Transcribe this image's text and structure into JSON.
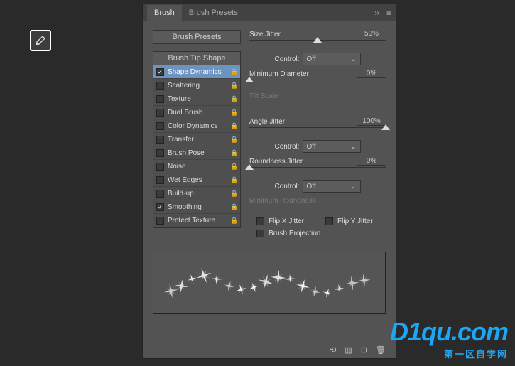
{
  "tool_icon": "brush-icon",
  "tabs": {
    "brush": "Brush",
    "presets": "Brush Presets"
  },
  "brush_presets_btn": "Brush Presets",
  "brush_tip_shape": "Brush Tip Shape",
  "options": [
    {
      "label": "Shape Dynamics",
      "checked": true,
      "selected": true
    },
    {
      "label": "Scattering",
      "checked": false
    },
    {
      "label": "Texture",
      "checked": false
    },
    {
      "label": "Dual Brush",
      "checked": false
    },
    {
      "label": "Color Dynamics",
      "checked": false
    },
    {
      "label": "Transfer",
      "checked": false
    },
    {
      "label": "Brush Pose",
      "checked": false
    },
    {
      "label": "Noise",
      "checked": false
    },
    {
      "label": "Wet Edges",
      "checked": false
    },
    {
      "label": "Build-up",
      "checked": false
    },
    {
      "label": "Smoothing",
      "checked": true
    },
    {
      "label": "Protect Texture",
      "checked": false
    }
  ],
  "fields": {
    "size_jitter": {
      "label": "Size Jitter",
      "value": "50%",
      "pos": 50
    },
    "control1": {
      "label": "Control:",
      "value": "Off"
    },
    "min_diameter": {
      "label": "Minimum Diameter",
      "value": "0%",
      "pos": 0
    },
    "tilt_scale": {
      "label": "Tilt Scale",
      "disabled": true
    },
    "angle_jitter": {
      "label": "Angle Jitter",
      "value": "100%",
      "pos": 100
    },
    "control2": {
      "label": "Control:",
      "value": "Off"
    },
    "roundness_jitter": {
      "label": "Roundness Jitter",
      "value": "0%",
      "pos": 0
    },
    "control3": {
      "label": "Control:",
      "value": "Off"
    },
    "min_roundness": {
      "label": "Minimum Roundness",
      "disabled": true
    },
    "flip_x": {
      "label": "Flip X Jitter",
      "checked": false
    },
    "flip_y": {
      "label": "Flip Y Jitter",
      "checked": false
    },
    "brush_proj": {
      "label": "Brush Projection",
      "checked": false
    }
  },
  "watermark": {
    "main": "D1qu.com",
    "sub": "第一区自学网"
  }
}
